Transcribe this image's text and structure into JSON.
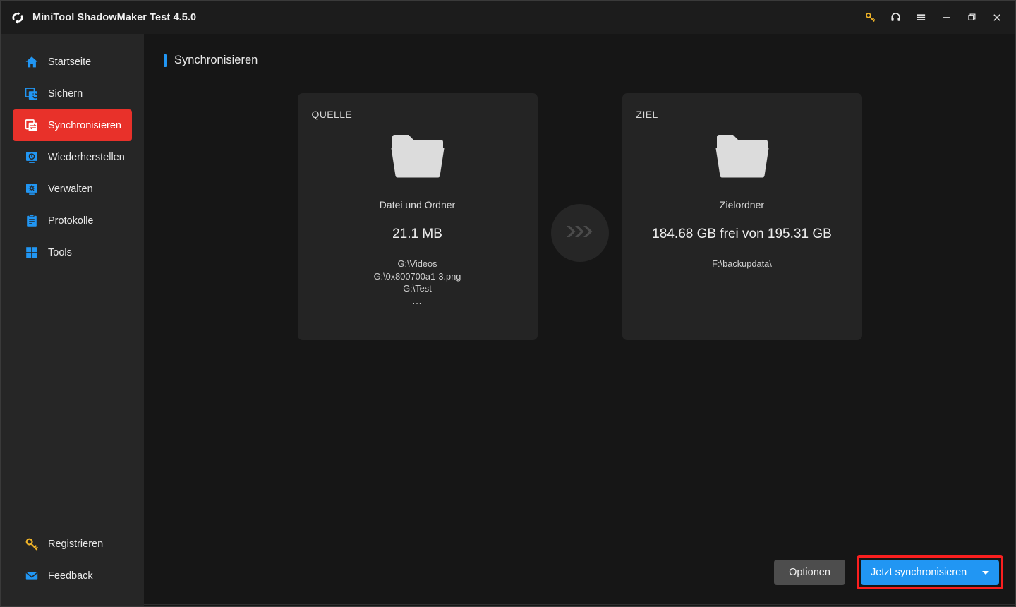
{
  "window": {
    "title": "MiniTool ShadowMaker Test 4.5.0",
    "logo_icon": "sync-circle-logo",
    "controls": [
      {
        "name": "key-icon",
        "label": "Registrieren",
        "color": "#f0b428"
      },
      {
        "name": "headset-icon",
        "label": "Support",
        "color": "#e8e8e8"
      },
      {
        "name": "menu-icon",
        "label": "Menü",
        "color": "#e8e8e8"
      },
      {
        "name": "minimize-icon",
        "label": "Minimieren",
        "color": "#e8e8e8"
      },
      {
        "name": "maximize-icon",
        "label": "Maximieren",
        "color": "#e8e8e8"
      },
      {
        "name": "close-icon",
        "label": "Schließen",
        "color": "#e8e8e8"
      }
    ]
  },
  "sidebar": {
    "items": [
      {
        "label": "Startseite",
        "icon": "home-icon",
        "active": false
      },
      {
        "label": "Sichern",
        "icon": "backup-icon",
        "active": false
      },
      {
        "label": "Synchronisieren",
        "icon": "sync-icon",
        "active": true
      },
      {
        "label": "Wiederherstellen",
        "icon": "restore-icon",
        "active": false
      },
      {
        "label": "Verwalten",
        "icon": "manage-icon",
        "active": false
      },
      {
        "label": "Protokolle",
        "icon": "logs-icon",
        "active": false
      },
      {
        "label": "Tools",
        "icon": "tools-icon",
        "active": false
      }
    ],
    "bottom_items": [
      {
        "label": "Registrieren",
        "icon": "key-icon",
        "color": "#f0b428"
      },
      {
        "label": "Feedback",
        "icon": "envelope-icon",
        "color": "#2196f3"
      }
    ],
    "active_color": "#e8312a",
    "icon_color": "#2196f3"
  },
  "page": {
    "title": "Synchronisieren",
    "accent_color": "#2196f3"
  },
  "sync": {
    "arrow_icon": "triple-chevron-right-icon",
    "source": {
      "label": "QUELLE",
      "icon": "folder-icon",
      "type": "Datei und Ordner",
      "size": "21.1 MB",
      "paths": [
        "G:\\Videos",
        "G:\\0x800700a1-3.png",
        "G:\\Test"
      ],
      "more": "..."
    },
    "destination": {
      "label": "ZIEL",
      "icon": "folder-icon",
      "type": "Zielordner",
      "capacity": "184.68 GB frei von 195.31 GB",
      "path": "F:\\backupdata\\"
    }
  },
  "footer": {
    "options_label": "Optionen",
    "sync_now_label": "Jetzt synchronisieren",
    "sync_now_color": "#2196f3",
    "highlight_color": "#fb1f1f",
    "dropdown_icon": "caret-down-icon"
  }
}
